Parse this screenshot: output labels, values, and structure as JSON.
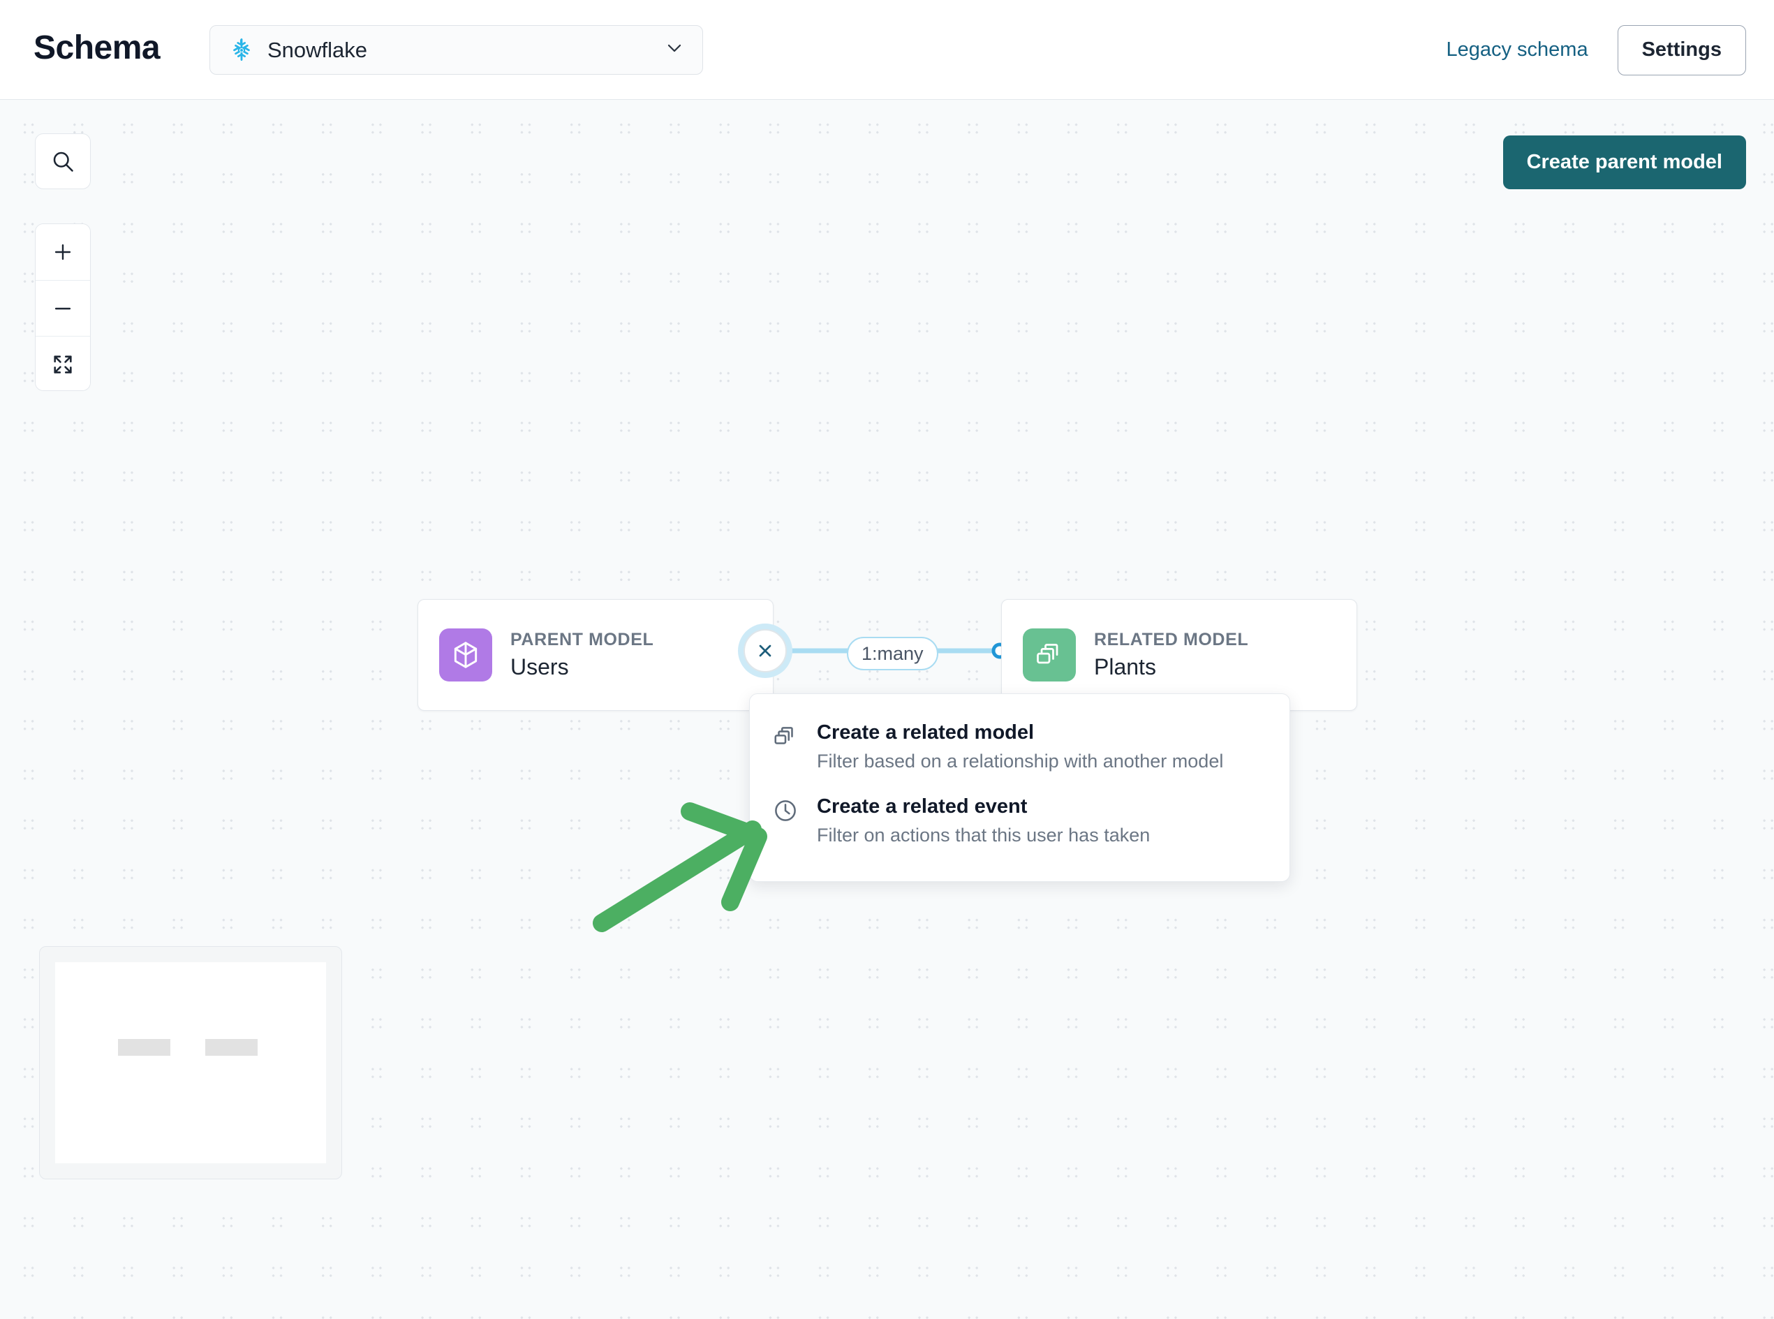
{
  "header": {
    "title": "Schema",
    "source_select": {
      "icon": "snowflake-icon",
      "value": "Snowflake",
      "chevron": "chevron-down-icon"
    },
    "legacy_schema_label": "Legacy schema",
    "settings_label": "Settings"
  },
  "canvas": {
    "controls": {
      "search_icon": "search-icon",
      "zoom_in_icon": "plus-icon",
      "zoom_out_icon": "minus-icon",
      "fit_view_icon": "expand-icon"
    },
    "create_parent_model_label": "Create parent model",
    "nodes": [
      {
        "kind_label": "PARENT MODEL",
        "name": "Users",
        "icon": "cube-icon",
        "icon_color": "#b07ae6"
      },
      {
        "kind_label": "RELATED MODEL",
        "name": "Plants",
        "icon": "stacked-boxes-icon",
        "icon_color": "#68c192"
      }
    ],
    "connector": {
      "remove_icon": "close-icon",
      "cardinality_label": "1:many",
      "line_color": "#a9dcf2"
    },
    "context_menu": {
      "items": [
        {
          "icon": "stacked-boxes-icon",
          "title": "Create a related model",
          "subtitle": "Filter based on a relationship with another model"
        },
        {
          "icon": "clock-icon",
          "title": "Create a related event",
          "subtitle": "Filter on actions that this user has taken"
        }
      ]
    },
    "annotation": {
      "shape": "arrow-icon",
      "color": "#4caf62"
    },
    "minimap": {
      "node_count": 2
    }
  },
  "colors": {
    "accent_teal": "#1b6670",
    "link_blue": "#156082",
    "snowflake_blue": "#29b5e8",
    "edge_blue": "#a9dcf2",
    "annotation_green": "#4caf62"
  }
}
